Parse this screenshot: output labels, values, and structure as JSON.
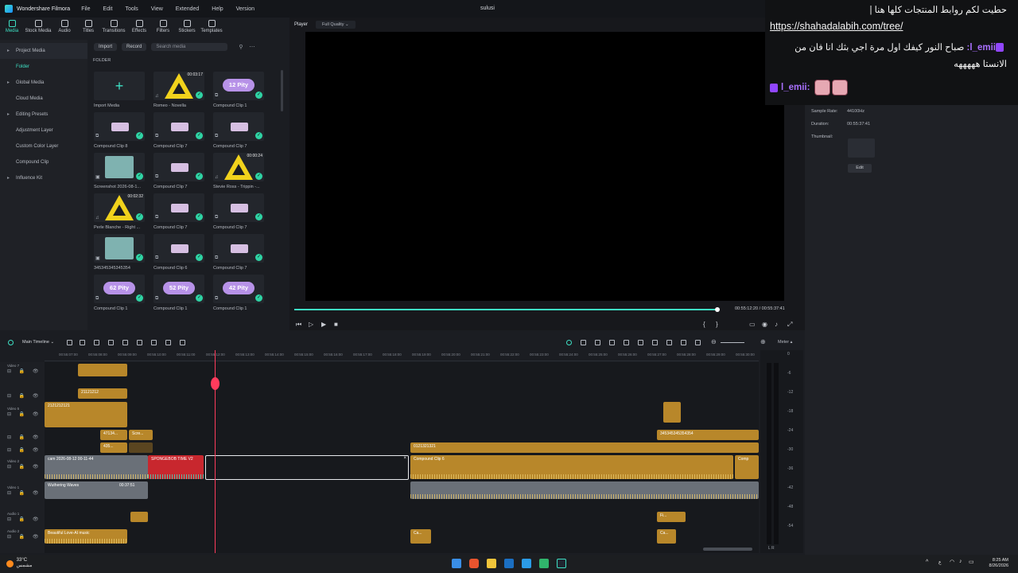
{
  "titlebar": {
    "app": "Wondershare Filmora",
    "menu": [
      "File",
      "Edit",
      "Tools",
      "View",
      "Extended",
      "Help",
      "Version"
    ],
    "project": "sulusi"
  },
  "toolbar": [
    {
      "label": "Media",
      "icon": "media-icon",
      "active": true
    },
    {
      "label": "Stock Media",
      "icon": "stock-icon"
    },
    {
      "label": "Audio",
      "icon": "music-icon"
    },
    {
      "label": "Titles",
      "icon": "text-icon"
    },
    {
      "label": "Transitions",
      "icon": "transitions-icon"
    },
    {
      "label": "Effects",
      "icon": "effects-icon"
    },
    {
      "label": "Filters",
      "icon": "filters-icon"
    },
    {
      "label": "Stickers",
      "icon": "stickers-icon"
    },
    {
      "label": "Templates",
      "icon": "templates-icon"
    }
  ],
  "leftnav": [
    "Project Media",
    "Folder",
    "Global Media",
    "Cloud Media",
    "Editing Presets",
    "Adjustment Layer",
    "Custom Color Layer",
    "Compound Clip",
    "Influence Kit"
  ],
  "media": {
    "import_label": "Import",
    "record_label": "Record",
    "search_placeholder": "Search media",
    "folder_label": "FOLDER",
    "items": [
      {
        "name": "Import Media",
        "kind": "import"
      },
      {
        "name": "Romeo - Novella",
        "kind": "tri",
        "duration": "00:03:17"
      },
      {
        "name": "Compound Clip 1",
        "kind": "pity",
        "text": "12 Pity"
      },
      {
        "name": "Compound Clip 8",
        "kind": "card"
      },
      {
        "name": "Compound Clip 7",
        "kind": "card"
      },
      {
        "name": "Compound Clip 7",
        "kind": "card"
      },
      {
        "name": "Screenshot 2026-08-1...",
        "kind": "shot"
      },
      {
        "name": "Compound Clip 7",
        "kind": "card"
      },
      {
        "name": "Stevie Ross - Trippin -...",
        "kind": "tri",
        "duration": "00:00:24"
      },
      {
        "name": "Perle Blanche - Right ...",
        "kind": "tri",
        "duration": "00:02:32"
      },
      {
        "name": "Compound Clip 7",
        "kind": "card"
      },
      {
        "name": "Compound Clip 7",
        "kind": "card"
      },
      {
        "name": "345345345345354",
        "kind": "shot"
      },
      {
        "name": "Compound Clip 6",
        "kind": "card"
      },
      {
        "name": "Compound Clip 7",
        "kind": "card"
      },
      {
        "name": "Compound Clip 1",
        "kind": "pity",
        "text": "62 Pity"
      },
      {
        "name": "Compound Clip 1",
        "kind": "pity",
        "text": "52 Pity"
      },
      {
        "name": "Compound Clip 1",
        "kind": "pity",
        "text": "42 Pity"
      }
    ]
  },
  "player": {
    "label": "Player",
    "quality": "Full Quality",
    "current_time": "00:55:12:20",
    "total_time": "00:55:37:41",
    "progress": 0.993
  },
  "properties": {
    "rows": [
      {
        "label": "Sample Rate:",
        "value": "44100Hz"
      },
      {
        "label": "Duration:",
        "value": "00:55:37:41"
      },
      {
        "label": "Thumbnail:",
        "value": ""
      }
    ],
    "edit_label": "Edit"
  },
  "chat": {
    "line1": "حطيت لكم روابط المنتجات كلها هنا |",
    "link": "https://shahadalabih.com/tree/",
    "user1": "l_emii:",
    "msg1a": "صباح النور كيفك اول مرة اجي بثك انا فان من",
    "msg1b": "الانستا هههههه",
    "user2": "l_emii:"
  },
  "timeline": {
    "label": "Main Timeline",
    "meter_label": "Meter",
    "ruler": [
      "00:55:07:00",
      "00:55:08:00",
      "00:55:09:00",
      "00:55:10:00",
      "00:55:11:00",
      "00:55:12:00",
      "00:55:13:00",
      "00:55:14:00",
      "00:55:15:00",
      "00:55:16:00",
      "00:55:17:00",
      "00:55:18:00",
      "00:55:19:00",
      "00:55:20:00",
      "00:55:21:00",
      "00:55:22:00",
      "00:55:23:00",
      "00:55:24:00",
      "00:55:25:00",
      "00:55:26:00",
      "00:55:27:00",
      "00:55:28:00",
      "00:55:29:00",
      "00:55:30:00",
      "00:55:31:00"
    ],
    "tracks": [
      "Video 7",
      "",
      "Video 5",
      "",
      "",
      "Video 2",
      "Video 1",
      "Audio 1",
      "Audio 2"
    ],
    "clips": {
      "c1": "21121212",
      "c2": "2121212121",
      "c3": "47134...",
      "c4": "Scre...",
      "c5": "435...",
      "c6": "cam 2026-08-12 00-11-44",
      "c7": "SPONGEBOB TIME V2",
      "c8": "0121321321",
      "c9": "Compound Clip 6",
      "c10": "Comp",
      "c11": "345345345354354",
      "c12": "Wuthering Waves",
      "c13": "00:37:51",
      "c14": "Beautiful Love-AI music",
      "c15": "Fi...",
      "c16": "Ca...",
      "c17": "Ca..."
    },
    "meter_scale": [
      "0",
      "-6",
      "-12",
      "-18",
      "-24",
      "-30",
      "-36",
      "-42",
      "-48",
      "-54"
    ],
    "meter_lr": "L  R"
  },
  "taskbar": {
    "temp": "33°C",
    "condition": "مشمس",
    "time": "8:25 AM",
    "date": "8/26/2026",
    "lang": "ع"
  }
}
